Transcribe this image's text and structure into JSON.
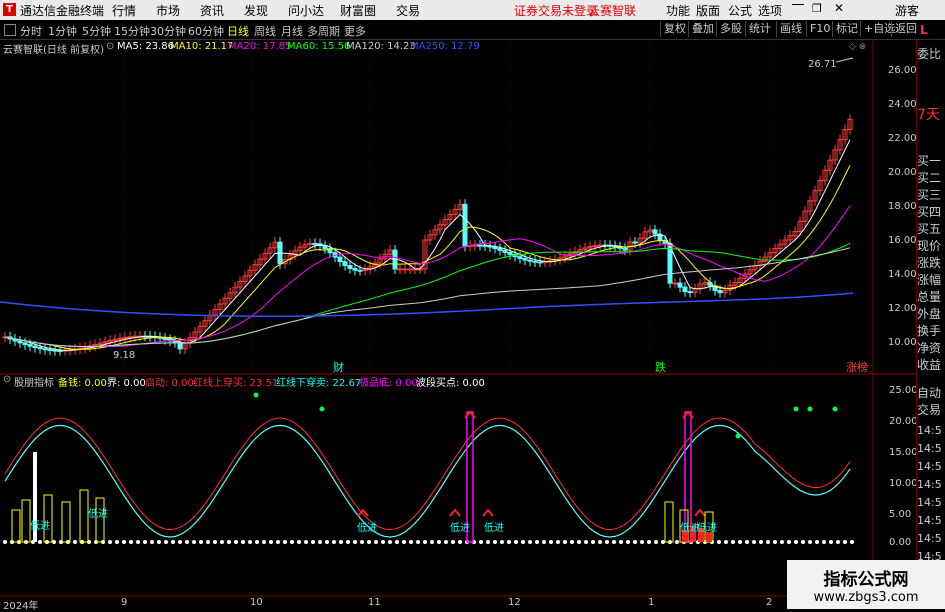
{
  "titlebar": {
    "app_title": "通达信金融终端",
    "menus": [
      "行情",
      "市场",
      "资讯",
      "发现",
      "问小达",
      "财富圈",
      "交易"
    ],
    "login_status": "证券交易未登录",
    "stock_label": "云赛智联",
    "right_menus": [
      "功能",
      "版面",
      "公式",
      "选项"
    ],
    "user": "游客"
  },
  "toolbar": {
    "periods": [
      "分时",
      "1分钟",
      "5分钟",
      "15分钟",
      "30分钟",
      "60分钟",
      "日线",
      "周线",
      "月线",
      "多周期",
      "更多"
    ],
    "active_period": "日线",
    "right_buttons": [
      "复权",
      "叠加",
      "多股",
      "统计",
      "画线",
      "F10",
      "标记",
      "+自选",
      "返回"
    ]
  },
  "main_chart": {
    "title": "云赛智联(日线 前复权)",
    "ma": [
      {
        "label": "MA5: 23.86",
        "color": "#ffffff"
      },
      {
        "label": "MA10: 21.17",
        "color": "#ffff00"
      },
      {
        "label": "MA20: 17.85",
        "color": "#ff00ff"
      },
      {
        "label": "MA60: 15.56",
        "color": "#00ff00"
      },
      {
        "label": "MA120: 14.23",
        "color": "#cccccc"
      },
      {
        "label": "MA250: 12.79",
        "color": "#3050ff"
      }
    ],
    "high_marker": "26.71",
    "low_marker": "9.18",
    "y_ticks": [
      "26.00",
      "24.00",
      "22.00",
      "20.00",
      "18.00",
      "16.00",
      "14.00",
      "12.00",
      "10.00"
    ],
    "event_labels": [
      {
        "text": "财",
        "color": "#00ffff"
      },
      {
        "text": "跌",
        "color": "#00ff00"
      },
      {
        "text": "涨榜",
        "color": "#ff4040"
      }
    ]
  },
  "indicator": {
    "title": "股朋指标",
    "values": [
      {
        "label": "备钱: 0.00",
        "color": "#ffff00"
      },
      {
        "label": "界: 0.00",
        "color": "#ffffff"
      },
      {
        "label": "启动: 0.00",
        "color": "#ff3030"
      },
      {
        "label": "红线上穿买: 23.51",
        "color": "#ff3030"
      },
      {
        "label": "红线下穿卖: 22.67",
        "color": "#00ffff"
      },
      {
        "label": "极品底: 0.00",
        "color": "#ff00ff"
      },
      {
        "label": "波段买点: 0.00",
        "color": "#ffffff"
      }
    ],
    "y_ticks": [
      "25.00",
      "20.00",
      "15.00",
      "10.00",
      "5.00",
      "0.00"
    ],
    "low_labels": [
      "低进",
      "低进",
      "低进",
      "低进",
      "低进",
      "低进",
      "低进"
    ]
  },
  "x_axis": [
    "2024年",
    "9",
    "10",
    "11",
    "12",
    "1",
    "2"
  ],
  "right_panel": {
    "top": "L",
    "items1": [
      "委比",
      "7天"
    ],
    "items2": [
      "买一",
      "买二",
      "买三",
      "买四",
      "买五",
      "现价",
      "涨跌",
      "涨幅",
      "总量",
      "外盘",
      "换手",
      "净资",
      "收益"
    ],
    "items3": [
      "自动",
      "交易"
    ],
    "times": [
      "14:5",
      "14:5",
      "14:5",
      "14:5",
      "14:5",
      "14:5",
      "14:5",
      "14:5"
    ]
  },
  "watermark": {
    "line1": "指标公式网",
    "line2": "www.zbgs3.com"
  }
}
